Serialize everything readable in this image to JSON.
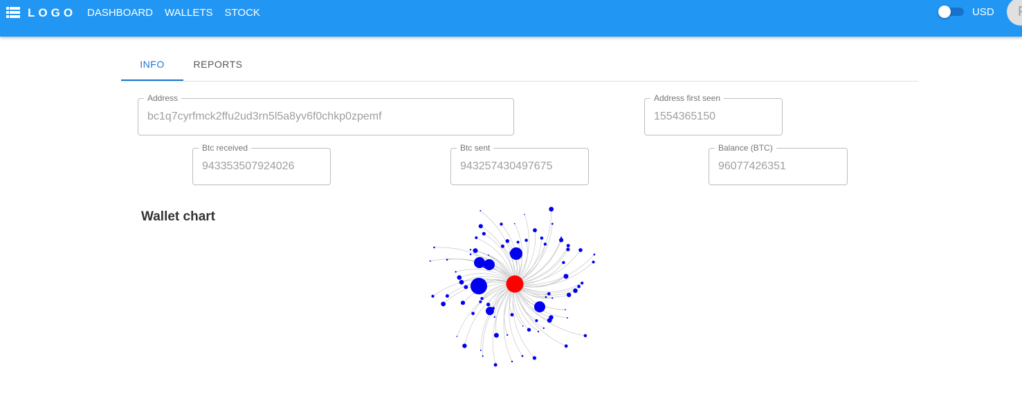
{
  "appbar": {
    "logo": "LOGO",
    "nav": [
      "DASHBOARD",
      "WALLETS",
      "STOCK"
    ],
    "currency": "USD",
    "avatar_initial": "F"
  },
  "tabs": [
    {
      "label": "INFO",
      "active": true
    },
    {
      "label": "REPORTS",
      "active": false
    }
  ],
  "fields": {
    "address": {
      "label": "Address",
      "value": "bc1q7cyrfmck2ffu2ud3rn5l5a8yv6f0chkp0zpemf"
    },
    "first_seen": {
      "label": "Address first seen",
      "value": "1554365150"
    },
    "btc_received": {
      "label": "Btc received",
      "value": "943353507924026"
    },
    "btc_sent": {
      "label": "Btc sent",
      "value": "943257430497675"
    },
    "balance": {
      "label": "Balance (BTC)",
      "value": "96077426351"
    }
  },
  "chart_title": "Wallet chart",
  "colors": {
    "primary": "#2196f3",
    "center_node": "#ff0000",
    "node": "#0000ee",
    "link": "#bdbdbd"
  },
  "icons": {
    "menu": "menu-icon"
  }
}
